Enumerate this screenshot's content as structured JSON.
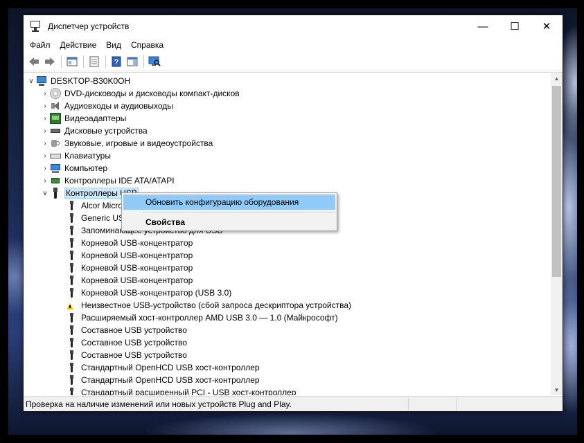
{
  "window": {
    "title": "Диспетчер устройств",
    "controls": {
      "minimize": "—",
      "maximize": "☐",
      "close": "✕"
    }
  },
  "menubar": {
    "items": [
      {
        "label": "Файл"
      },
      {
        "label": "Действие"
      },
      {
        "label": "Вид"
      },
      {
        "label": "Справка"
      }
    ]
  },
  "toolbar": {
    "buttons": [
      {
        "icon": "back-arrow-icon"
      },
      {
        "icon": "forward-arrow-icon"
      },
      {
        "icon": "show-hide-console-tree-icon"
      },
      {
        "icon": "properties-icon"
      },
      {
        "icon": "help-icon"
      },
      {
        "icon": "action-pane-icon"
      },
      {
        "icon": "scan-hardware-icon"
      }
    ]
  },
  "tree": {
    "root": "DESKTOP-B30K0OH",
    "categories": [
      {
        "label": "DVD-дисководы и дисководы компакт-дисков",
        "icon": "disc-drive-icon"
      },
      {
        "label": "Аудиовходы и аудиовыходы",
        "icon": "audio-io-icon"
      },
      {
        "label": "Видеоадаптеры",
        "icon": "display-adapter-icon"
      },
      {
        "label": "Дисковые устройства",
        "icon": "disk-drive-icon"
      },
      {
        "label": "Звуковые, игровые и видеоустройства",
        "icon": "sound-device-icon"
      },
      {
        "label": "Клавиатуры",
        "icon": "keyboard-icon"
      },
      {
        "label": "Компьютер",
        "icon": "computer-icon"
      },
      {
        "label": "Контроллеры IDE ATA/ATAPI",
        "icon": "ide-controller-icon"
      },
      {
        "label": "Контроллеры USB",
        "icon": "usb-controller-icon"
      }
    ],
    "usb_children": [
      {
        "label": "Alcor Micro USB Card Reader",
        "warning": false
      },
      {
        "label": "Generic USB Hub",
        "warning": false
      },
      {
        "label": "Запоминающее устройство для USB",
        "warning": false
      },
      {
        "label": "Корневой USB-концентратор",
        "warning": false
      },
      {
        "label": "Корневой USB-концентратор",
        "warning": false
      },
      {
        "label": "Корневой USB-концентратор",
        "warning": false
      },
      {
        "label": "Корневой USB-концентратор",
        "warning": false
      },
      {
        "label": "Корневой USB-концентратор (USB 3.0)",
        "warning": false
      },
      {
        "label": "Неизвестное USB-устройство (сбой запроса дескриптора устройства)",
        "warning": true
      },
      {
        "label": "Расширяемый хост-контроллер AMD USB 3.0 — 1.0 (Майкрософт)",
        "warning": false
      },
      {
        "label": "Составное USB устройство",
        "warning": false
      },
      {
        "label": "Составное USB устройство",
        "warning": false
      },
      {
        "label": "Составное USB устройство",
        "warning": false
      },
      {
        "label": "Стандартный OpenHCD USB хост-контроллер",
        "warning": false
      },
      {
        "label": "Стандартный OpenHCD USB хост-контроллер",
        "warning": false
      },
      {
        "label": "Стандартный расширенный PCI - USB хост-контроллер",
        "warning": false
      }
    ]
  },
  "context_menu": {
    "items": [
      {
        "label": "Обновить конфигурацию оборудования",
        "highlighted": true,
        "bold": false
      },
      {
        "label": "Свойства",
        "highlighted": false,
        "bold": true
      }
    ]
  },
  "statusbar": {
    "text": "Проверка на наличие изменений или новых устройств Plug and Play."
  },
  "colors": {
    "selection": "#cce8ff",
    "menu_highlight": "#91c9f7",
    "monitor_blue": "#3b88d8"
  }
}
